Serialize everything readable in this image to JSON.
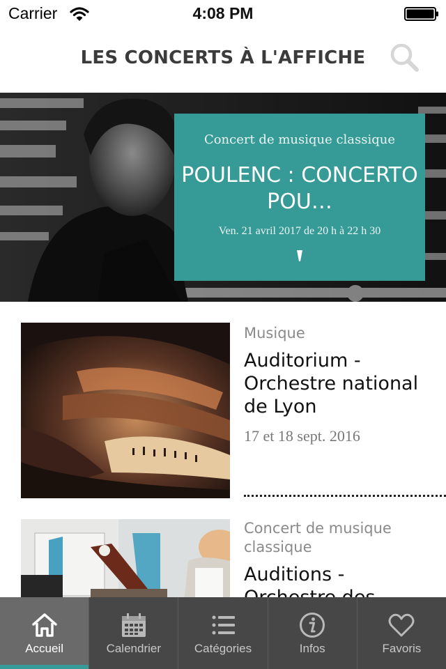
{
  "status_bar": {
    "carrier": "Carrier",
    "time": "4:08 PM"
  },
  "header": {
    "title": "LES CONCERTS À L'AFFICHE",
    "search_icon": "search-icon"
  },
  "hero": {
    "category": "Concert de musique classique",
    "title": "POULENC : CONCERTO POU…",
    "date": "Ven. 21 avril 2017 de 20 h à 22 h 30",
    "card_color": "#369a97"
  },
  "events": [
    {
      "category": "Musique",
      "title": "Auditorium - Orchestre national de Lyon",
      "date": "17 et 18 sept. 2016"
    },
    {
      "category": "Concert de musique classique",
      "title": "Auditions - Orchestre des"
    }
  ],
  "tabs": [
    {
      "label": "Accueil",
      "icon": "home-icon",
      "active": true
    },
    {
      "label": "Calendrier",
      "icon": "calendar-icon",
      "active": false
    },
    {
      "label": "Catégories",
      "icon": "list-icon",
      "active": false
    },
    {
      "label": "Infos",
      "icon": "info-icon",
      "active": false
    },
    {
      "label": "Favoris",
      "icon": "heart-icon",
      "active": false
    }
  ],
  "colors": {
    "accent": "#369a97",
    "tab_bar": "#474747",
    "tab_active": "#6a6a6a"
  }
}
